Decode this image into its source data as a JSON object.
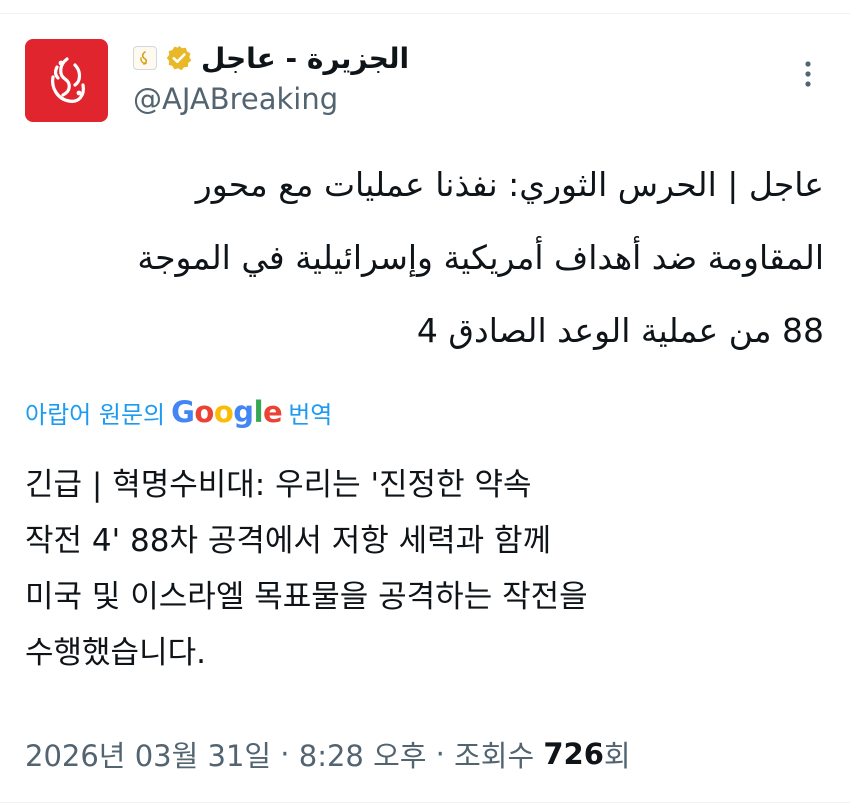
{
  "author": {
    "display_name": "الجزيرة - عاجل",
    "handle": "@AJABreaking",
    "verified_icon": "verified-gold-badge",
    "affiliate_icon": "al-jazeera-affiliate-badge",
    "avatar_icon": "al-jazeera-logo"
  },
  "tweet": {
    "original_lines": [
      "عاجل | الحرس الثوري: نفذنا عمليات مع محور",
      "المقاومة ضد أهداف أمريكية وإسرائيلية في الموجة",
      "88 من عملية الوعد الصادق 4"
    ],
    "translate_prefix": "아랍어 원문의",
    "translate_suffix": "번역",
    "translated_lines": [
      "긴급 | 혁명수비대: 우리는 '진정한 약속",
      "작전 4' 88차 공격에서 저항 세력과 함께",
      "미국 및 이스라엘 목표물을 공격하는 작전을",
      "수행했습니다."
    ]
  },
  "meta": {
    "date": "2026년 03월 31일",
    "separator": " · ",
    "time": "8:28 오후",
    "views_label": "조회수",
    "views_count": "726",
    "views_unit": "회"
  },
  "colors": {
    "link": "#1d9bf0",
    "secondary_text": "#536471",
    "avatar_bg": "#e0252e",
    "verified_gold": "#e8b829"
  }
}
